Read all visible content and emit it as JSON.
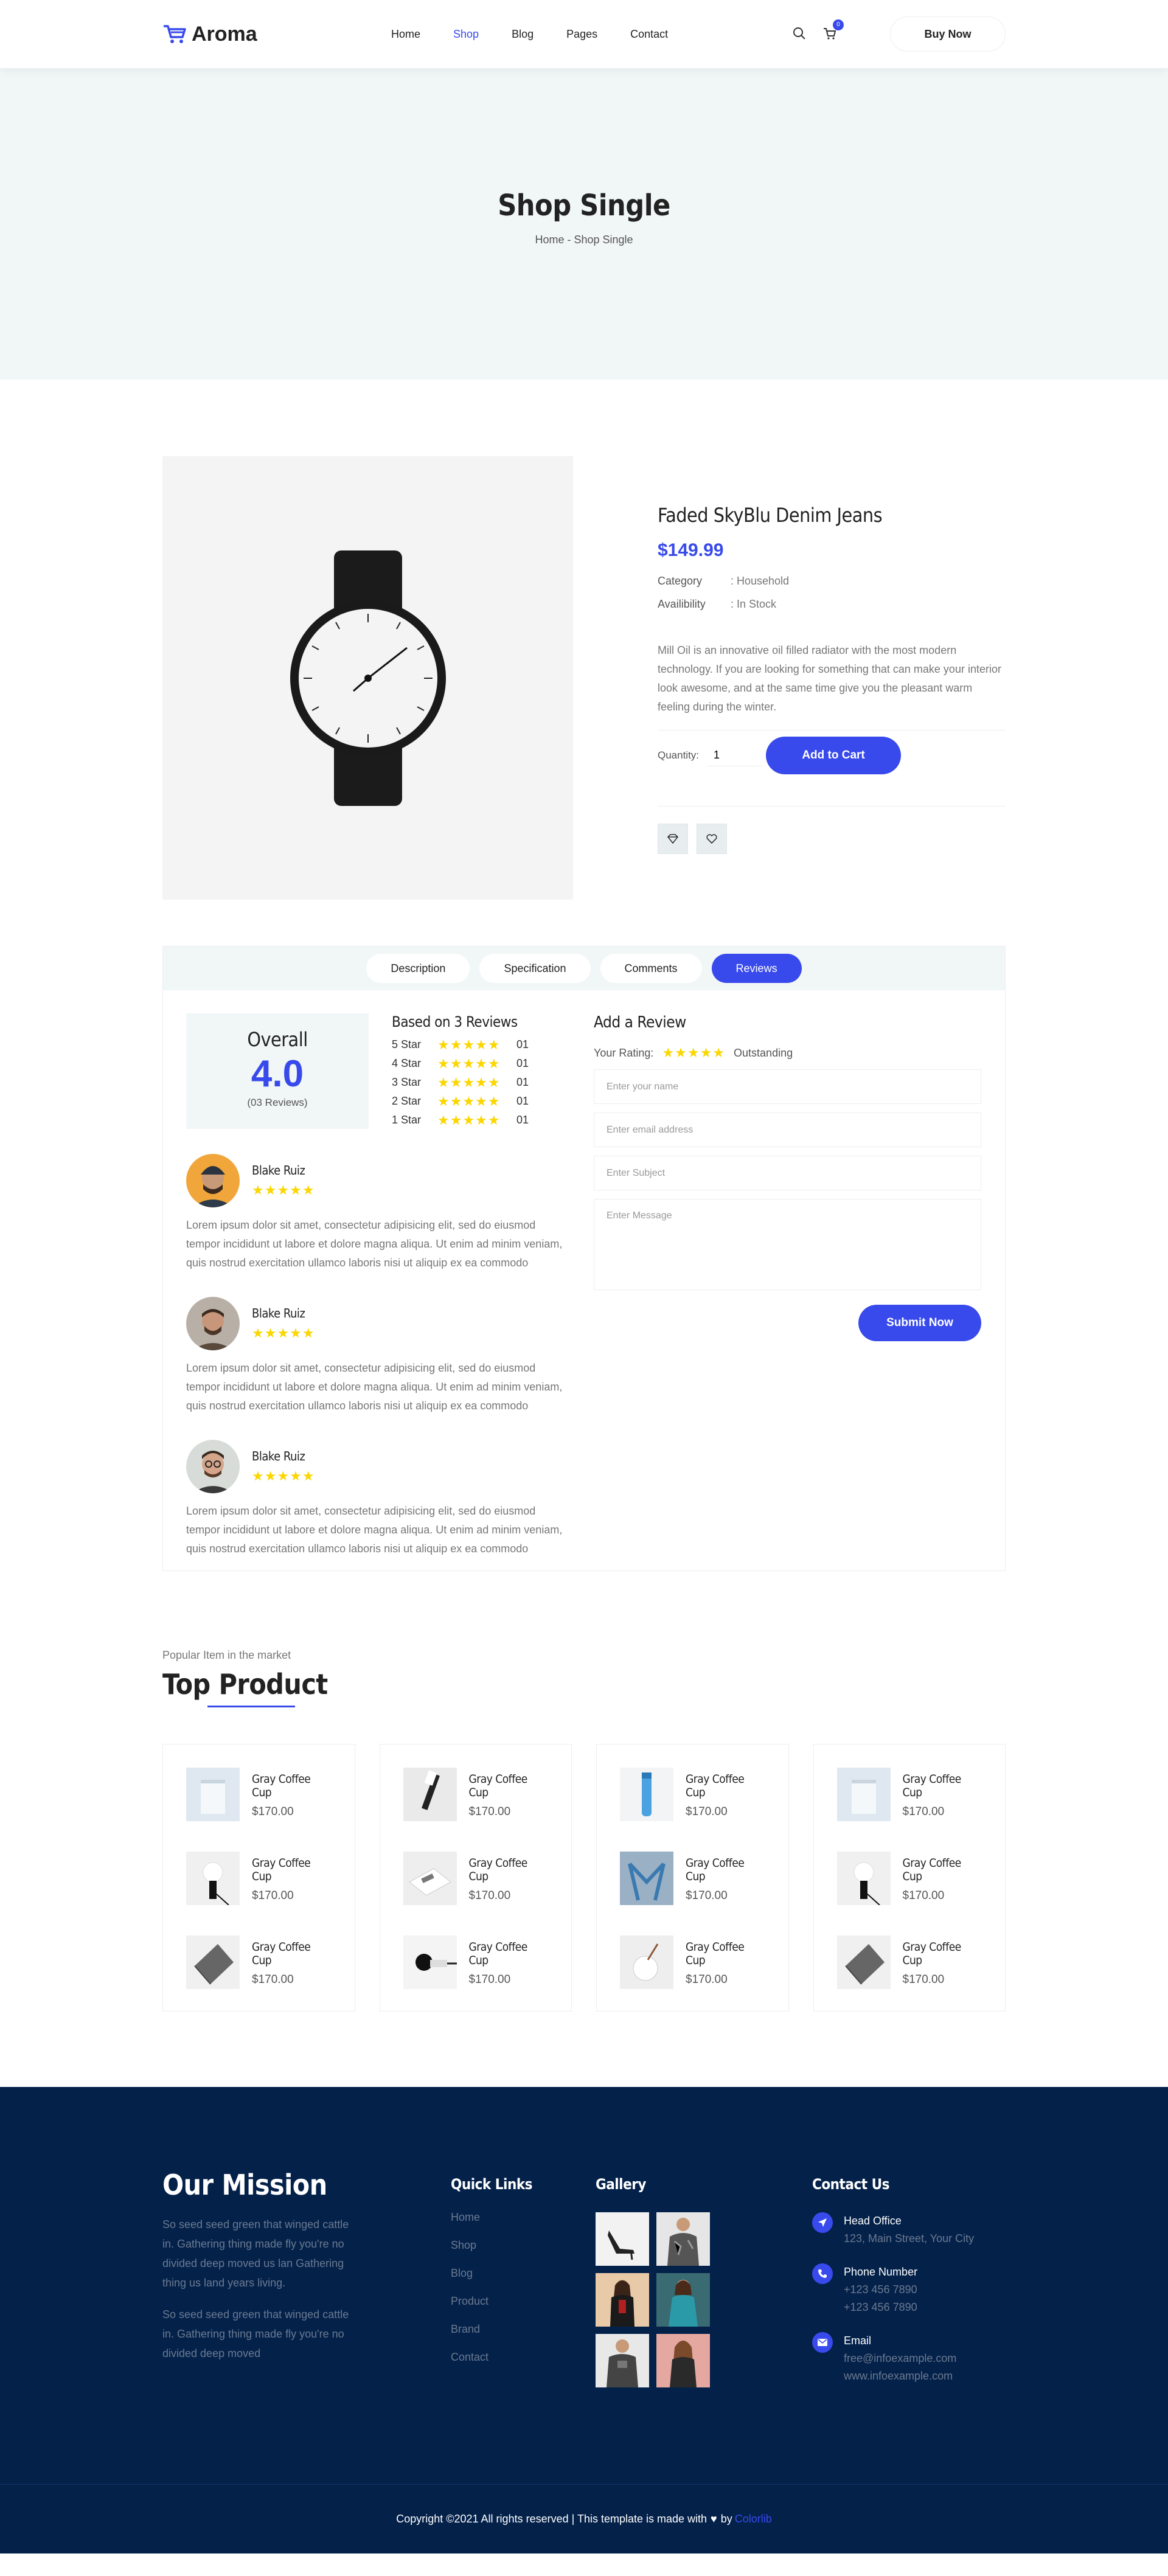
{
  "header": {
    "logo_text": "Aroma",
    "nav": [
      "Home",
      "Shop",
      "Blog",
      "Pages",
      "Contact"
    ],
    "active_nav": "Shop",
    "cart_count": "0",
    "buy_label": "Buy Now"
  },
  "banner": {
    "title": "Shop Single",
    "crumb_home": "Home",
    "crumb_sep": " - ",
    "crumb_current": "Shop Single"
  },
  "product": {
    "name": "Faded SkyBlu Denim Jeans",
    "price": "$149.99",
    "category_label": "Category",
    "category_value": ": Household",
    "avail_label": "Availibility",
    "avail_value": ": In Stock",
    "description": "Mill Oil is an innovative oil filled radiator with the most modern technology. If you are looking for something that can make your interior look awesome, and at the same time give you the pleasant warm feeling during the winter.",
    "quantity_label": "Quantity:",
    "quantity_value": "1",
    "add_to_cart": "Add to Cart"
  },
  "tabs": [
    "Description",
    "Specification",
    "Comments",
    "Reviews"
  ],
  "reviews": {
    "overall_label": "Overall",
    "overall_score": "4.0",
    "overall_count": "(03 Reviews)",
    "based_on": "Based on 3 Reviews",
    "breakdown": [
      {
        "label": "5 Star",
        "count": "01"
      },
      {
        "label": "4 Star",
        "count": "01"
      },
      {
        "label": "3 Star",
        "count": "01"
      },
      {
        "label": "2 Star",
        "count": "01"
      },
      {
        "label": "1 Star",
        "count": "01"
      }
    ],
    "items": [
      {
        "name": "Blake Ruiz",
        "text": "Lorem ipsum dolor sit amet, consectetur adipisicing elit, sed do eiusmod tempor incididunt ut labore et dolore magna aliqua. Ut enim ad minim veniam, quis nostrud exercitation ullamco laboris nisi ut aliquip ex ea commodo"
      },
      {
        "name": "Blake Ruiz",
        "text": "Lorem ipsum dolor sit amet, consectetur adipisicing elit, sed do eiusmod tempor incididunt ut labore et dolore magna aliqua. Ut enim ad minim veniam, quis nostrud exercitation ullamco laboris nisi ut aliquip ex ea commodo"
      },
      {
        "name": "Blake Ruiz",
        "text": "Lorem ipsum dolor sit amet, consectetur adipisicing elit, sed do eiusmod tempor incididunt ut labore et dolore magna aliqua. Ut enim ad minim veniam, quis nostrud exercitation ullamco laboris nisi ut aliquip ex ea commodo"
      }
    ]
  },
  "review_form": {
    "title": "Add a Review",
    "your_rating_label": "Your Rating:",
    "rating_word": "Outstanding",
    "name_placeholder": "Enter your name",
    "email_placeholder": "Enter email address",
    "subject_placeholder": "Enter Subject",
    "message_placeholder": "Enter Message",
    "submit": "Submit Now"
  },
  "top_products": {
    "pre": "Popular Item in the market",
    "title": "Top Product",
    "item_name": "Gray Coffee Cup",
    "item_price": "$170.00"
  },
  "footer": {
    "mission_title": "Our Mission",
    "mission_p1": "So seed seed green that winged cattle in. Gathering thing made fly you're no divided deep moved us lan Gathering thing us land years living.",
    "mission_p2": "So seed seed green that winged cattle in. Gathering thing made fly you're no divided deep moved",
    "links_title": "Quick Links",
    "links": [
      "Home",
      "Shop",
      "Blog",
      "Product",
      "Brand",
      "Contact"
    ],
    "gallery_title": "Gallery",
    "contact_title": "Contact Us",
    "head_office_label": "Head Office",
    "head_office_value": "123, Main Street, Your City",
    "phone_label": "Phone Number",
    "phone_1": "+123 456 7890",
    "phone_2": "+123 456 7890",
    "email_label": "Email",
    "email_1": "free@infoexample.com",
    "email_2": "www.infoexample.com",
    "copyright": "Copyright ©2021 All rights reserved | This template is made with",
    "by": "by",
    "brand": "Colorlib"
  }
}
